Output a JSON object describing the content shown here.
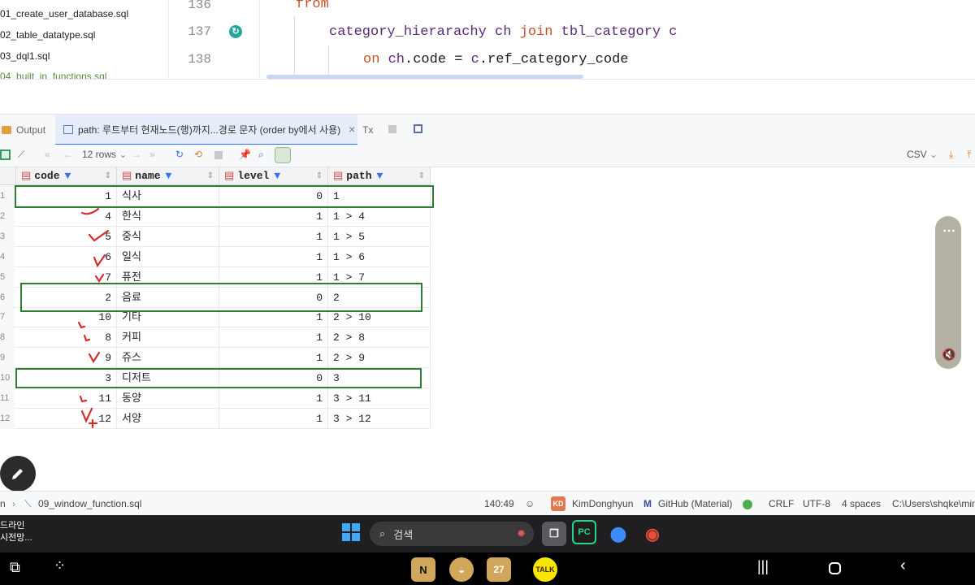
{
  "project_files": [
    {
      "label": "01_create_user_database.sql",
      "vcs": false
    },
    {
      "label": "02_table_datatype.sql",
      "vcs": false
    },
    {
      "label": "03_dql1.sql",
      "vcs": false
    },
    {
      "label": "04_built_in_functions.sql",
      "vcs": true
    }
  ],
  "editor": {
    "line_numbers": [
      "136",
      "137",
      "138"
    ],
    "line136": {
      "kw": "from"
    },
    "line137": {
      "t1": "category_hierarachy",
      "t2": "ch",
      "t3": "join",
      "t4": "tbl_category",
      "t5": "c"
    },
    "line138": {
      "t1": "on",
      "t2": "ch",
      "t3": ".code = ",
      "t4": "c",
      "t5": ".ref_category_code"
    }
  },
  "tool_tabs": {
    "output": "Output",
    "result_tab": "path: 루트부터 현재노드(행)까지...경로 문자 (order by에서 사용)",
    "close": "×",
    "tx": "Tx"
  },
  "grid_toolbar": {
    "rows": "12 rows",
    "export_format": "CSV"
  },
  "table": {
    "columns": [
      "code",
      "name",
      "level",
      "path"
    ],
    "rows": [
      {
        "n": "1",
        "code": "1",
        "name": "식사",
        "level": "0",
        "path": "1"
      },
      {
        "n": "2",
        "code": "4",
        "name": "한식",
        "level": "1",
        "path": "1 > 4"
      },
      {
        "n": "3",
        "code": "5",
        "name": "중식",
        "level": "1",
        "path": "1 > 5"
      },
      {
        "n": "4",
        "code": "6",
        "name": "일식",
        "level": "1",
        "path": "1 > 6"
      },
      {
        "n": "5",
        "code": "7",
        "name": "퓨전",
        "level": "1",
        "path": "1 > 7"
      },
      {
        "n": "6",
        "code": "2",
        "name": "음료",
        "level": "0",
        "path": "2"
      },
      {
        "n": "7",
        "code": "10",
        "name": "기타",
        "level": "1",
        "path": "2 > 10"
      },
      {
        "n": "8",
        "code": "8",
        "name": "커피",
        "level": "1",
        "path": "2 > 8"
      },
      {
        "n": "9",
        "code": "9",
        "name": "쥬스",
        "level": "1",
        "path": "2 > 9"
      },
      {
        "n": "10",
        "code": "3",
        "name": "디저트",
        "level": "0",
        "path": "3"
      },
      {
        "n": "11",
        "code": "11",
        "name": "동양",
        "level": "1",
        "path": "3 > 11"
      },
      {
        "n": "12",
        "code": "12",
        "name": "서양",
        "level": "1",
        "path": "3 > 12"
      }
    ]
  },
  "status_bar": {
    "breadcrumb_prefix": "n",
    "file": "09_window_function.sql",
    "position": "140:49",
    "user_initials": "KD",
    "user": "KimDonghyun",
    "theme": "GitHub (Material)",
    "line_sep": "CRLF",
    "encoding": "UTF-8",
    "indent": "4 spaces",
    "path": "C:\\Users\\shqke\\min"
  },
  "taskbar": {
    "left_line1": "드라인",
    "left_line2": "시전망...",
    "search_placeholder": "검색",
    "calendar_day": "27",
    "kakao": "TALK",
    "notion": "N"
  },
  "colors": {
    "highlight_box": "#2e7d32",
    "accent": "#3574f0",
    "annotation_red": "#d32f2f"
  }
}
